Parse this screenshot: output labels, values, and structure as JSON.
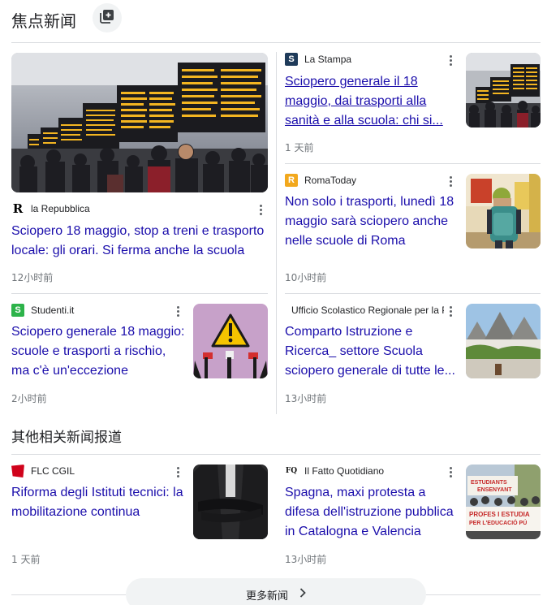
{
  "header": {
    "title": "焦点新闻",
    "action_icon": "add-to-library-icon"
  },
  "top_stories": [
    {
      "source": "la Repubblica",
      "favicon_text": "R",
      "favicon_color": "#ffffff",
      "title": "Sciopero 18 maggio, stop a treni e trasporto locale: gli orari. Si ferma anche la scuola",
      "time": "12小时前"
    },
    {
      "source": "La Stampa",
      "favicon_text": "S",
      "favicon_color": "#1f3b5a",
      "title": "Sciopero generale il 18 maggio, dai trasporti alla sanità e alla scuola: chi si...",
      "time": "1 天前"
    },
    {
      "source": "RomaToday",
      "favicon_text": "R",
      "favicon_color": "#f2a81d",
      "title": "Non solo i trasporti, lunedì 18 maggio sarà sciopero anche nelle scuole di Roma",
      "time": "10小时前"
    },
    {
      "source": "Studenti.it",
      "favicon_text": "S",
      "favicon_color": "#2db34a",
      "title": "Sciopero generale 18 maggio: scuole e trasporti a rischio, ma c'è un'eccezione",
      "time": "2小时前"
    },
    {
      "source": "Ufficio Scolastico Regionale per la Puglia",
      "favicon_text": "",
      "favicon_color": "#ffffff",
      "title": "Comparto Istruzione e Ricerca_ settore Scuola sciopero generale di tutte le...",
      "time": "13小时前"
    }
  ],
  "related": {
    "title": "其他相关新闻报道",
    "items": [
      {
        "source": "FLC CGIL",
        "favicon_text": "",
        "favicon_color": "#d0021b",
        "title": "Riforma degli Istituti tecnici: la mobilitazione continua",
        "time": "1 天前"
      },
      {
        "source": "Il Fatto Quotidiano",
        "favicon_text": "FQ",
        "favicon_color": "#ffffff",
        "title": "Spagna, maxi protesta a difesa dell'istruzione pubblica in Catalogna e Valencia",
        "time": "13小时前"
      }
    ]
  },
  "banner_texts": [
    "ESTUDIANTS",
    "ENSENYANT",
    "PROFES I ESTUDIA",
    "PER L'EDUCACIÓ PÚ"
  ],
  "footer": {
    "more_label": "更多新闻"
  }
}
